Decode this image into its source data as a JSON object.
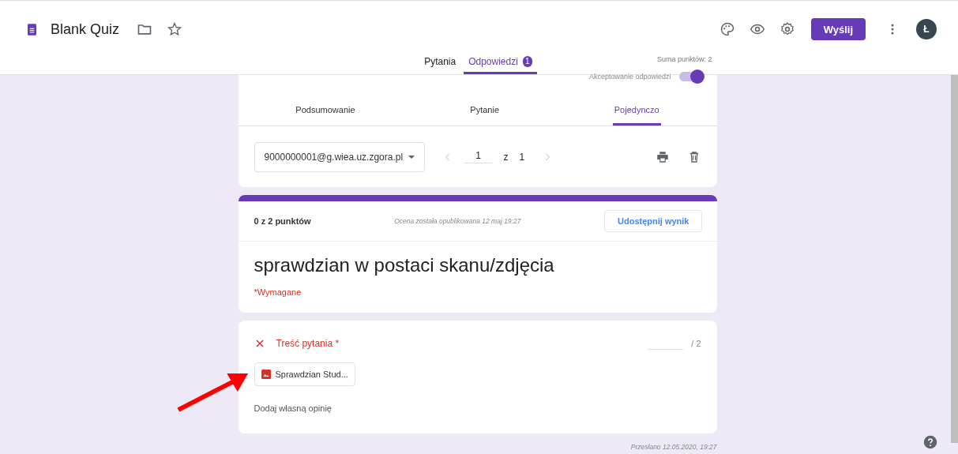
{
  "header": {
    "title": "Blank Quiz",
    "send_button": "Wyślij",
    "avatar": "Ł"
  },
  "tabs": [
    {
      "label": "Pytania",
      "selected": false
    },
    {
      "label": "Odpowiedzi",
      "selected": true,
      "badge": "1"
    }
  ],
  "total_points": "Suma punktów: 2",
  "accepting": {
    "label": "Akceptowanie odpowiedzi",
    "on": true
  },
  "response_tabs": [
    {
      "label": "Podsumowanie",
      "selected": false
    },
    {
      "label": "Pytanie",
      "selected": false
    },
    {
      "label": "Pojedynczo",
      "selected": true
    }
  ],
  "respondent": {
    "email": "9000000001@g.wiea.uz.zgora.pl",
    "current": "1",
    "of": "z",
    "total": "1"
  },
  "result": {
    "score": "0 z 2 punktów",
    "published": "Ocena została opublikowana 12 maj 19:27",
    "share_button": "Udostępnij wynik"
  },
  "form": {
    "title": "sprawdzian w postaci skanu/zdjęcia",
    "required_note": "*Wymagane"
  },
  "question": {
    "title": "Treść pytania *",
    "correct": false,
    "max_points": "/ 2",
    "file": "Sprawdzian Stud...",
    "feedback": "Dodaj własną opinię"
  },
  "submitted": "Przesłano 12.05.2020, 19:27"
}
